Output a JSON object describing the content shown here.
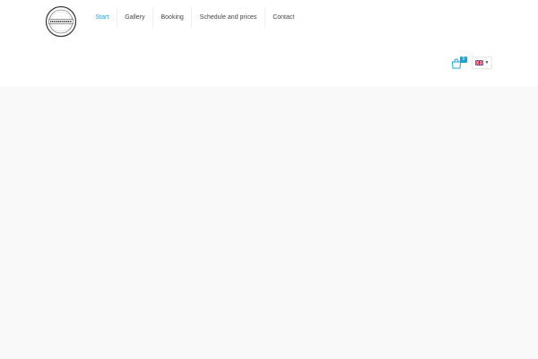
{
  "header": {
    "logo": {
      "icon": "circular-stamp-logo-icon"
    },
    "nav": {
      "items": [
        {
          "label": "Start",
          "active": true
        },
        {
          "label": "Gallery",
          "active": false
        },
        {
          "label": "Booking",
          "active": false
        },
        {
          "label": "Schedule and prices",
          "active": false
        },
        {
          "label": "Contact",
          "active": false
        }
      ]
    },
    "cart": {
      "icon": "shopping-bag-icon",
      "count": "0"
    },
    "language": {
      "icon": "uk-flag-icon",
      "chevron": "chevron-down-icon"
    }
  },
  "colors": {
    "accent": "#1d9fd6",
    "text": "#444444",
    "content_background": "#f9f9f9"
  }
}
